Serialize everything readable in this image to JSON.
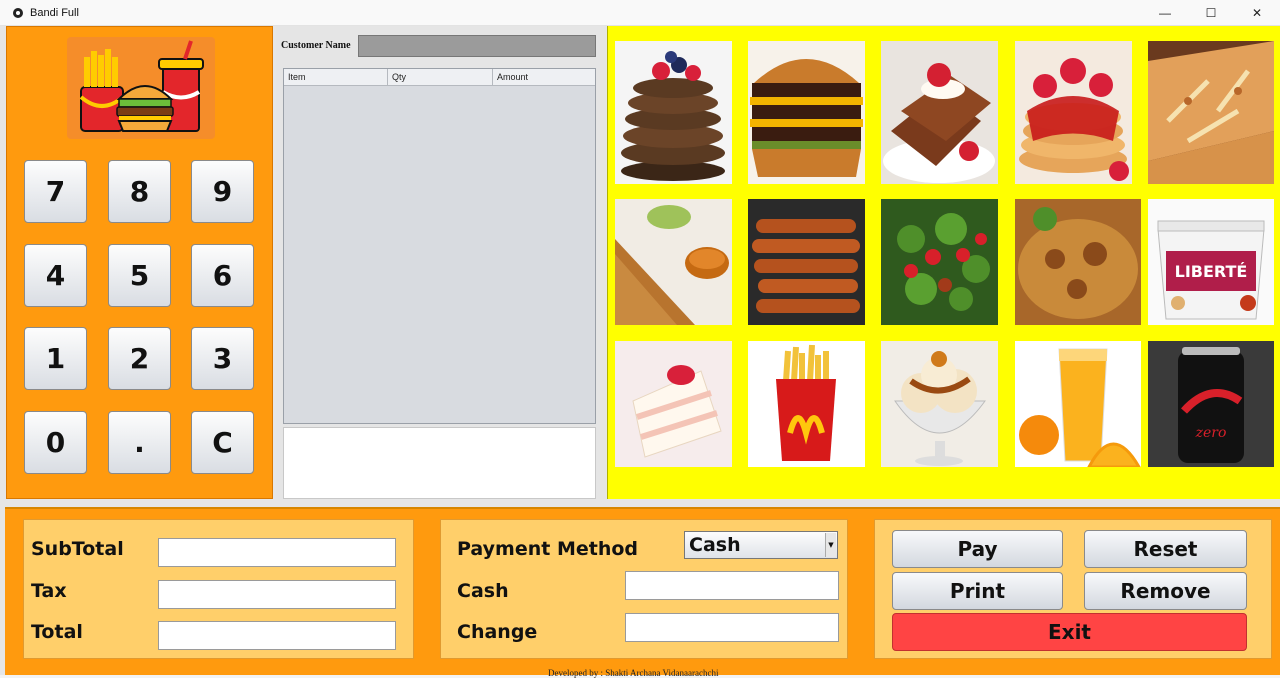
{
  "window": {
    "title": "Bandi Full",
    "controls": {
      "minimize": "—",
      "maximize": "☐",
      "close": "✕"
    }
  },
  "keypad": {
    "keys": [
      "7",
      "8",
      "9",
      "4",
      "5",
      "6",
      "1",
      "2",
      "3",
      "0",
      ".",
      "C"
    ]
  },
  "order": {
    "customer_label": "Customer Name",
    "customer_value": "",
    "columns": [
      "Item",
      "Qty",
      "Amount"
    ],
    "rows": []
  },
  "menu": {
    "items": [
      "pancakes",
      "burger",
      "french-toast",
      "strawberry-pancakes",
      "pizza",
      "dosa",
      "sausages",
      "salad",
      "biryani",
      "yogurt",
      "cake",
      "fries",
      "sundae",
      "orange-juice",
      "coke-zero"
    ]
  },
  "totals": {
    "subtotal_label": "SubTotal",
    "tax_label": "Tax",
    "total_label": "Total",
    "subtotal": "",
    "tax": "",
    "total": ""
  },
  "payment": {
    "method_label": "Payment Method",
    "method_value": "Cash",
    "cash_label": "Cash",
    "change_label": "Change",
    "cash": "",
    "change": ""
  },
  "actions": {
    "pay": "Pay",
    "reset": "Reset",
    "print": "Print",
    "remove": "Remove",
    "exit": "Exit"
  },
  "footer": "Developed by : Shakti Archana Vidanaarachchi",
  "colors": {
    "orange": "#ff9a0e",
    "yellow": "#ffff00",
    "panel": "#ffcf6a",
    "exit": "#ff4444"
  }
}
